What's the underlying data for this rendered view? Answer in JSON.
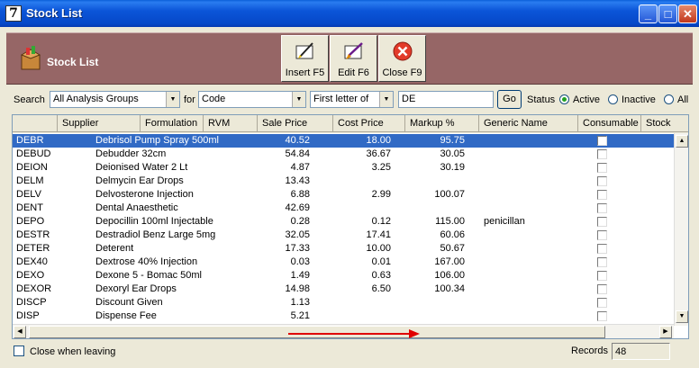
{
  "window": {
    "title": "Stock List",
    "app_icon_label": "7"
  },
  "header": {
    "title": "Stock List"
  },
  "toolbar": {
    "insert": "Insert F5",
    "edit": "Edit F6",
    "close": "Close F9"
  },
  "search": {
    "label": "Search",
    "group": "All Analysis Groups",
    "for_label": "for",
    "field": "Code",
    "mode": "First letter of",
    "value": "DE",
    "go": "Go",
    "status_label": "Status",
    "status_options": [
      "Active",
      "Inactive",
      "All"
    ],
    "status_selected": "Active"
  },
  "grid": {
    "columns": [
      "Supplier",
      "Formulation",
      "RVM",
      "Sale Price",
      "Cost Price",
      "Markup %",
      "Generic Name",
      "Consumable",
      "Stock"
    ],
    "rows": [
      {
        "code": "DEBR",
        "name": "Debrisol Pump Spray 500ml",
        "sale": "40.52",
        "cost": "18.00",
        "markup": "95.75",
        "generic": "",
        "selected": true
      },
      {
        "code": "DEBUD",
        "name": "Debudder 32cm",
        "sale": "54.84",
        "cost": "36.67",
        "markup": "30.05",
        "generic": ""
      },
      {
        "code": "DEION",
        "name": "Deionised Water 2 Lt",
        "sale": "4.87",
        "cost": "3.25",
        "markup": "30.19",
        "generic": ""
      },
      {
        "code": "DELM",
        "name": "Delmycin Ear Drops",
        "sale": "13.43",
        "cost": "",
        "markup": "",
        "generic": ""
      },
      {
        "code": "DELV",
        "name": "Delvosterone  Injection",
        "sale": "6.88",
        "cost": "2.99",
        "markup": "100.07",
        "generic": ""
      },
      {
        "code": "DENT",
        "name": "Dental Anaesthetic",
        "sale": "42.69",
        "cost": "",
        "markup": "",
        "generic": ""
      },
      {
        "code": "DEPO",
        "name": "Depocillin 100ml Injectable",
        "sale": "0.28",
        "cost": "0.12",
        "markup": "115.00",
        "generic": "penicillan"
      },
      {
        "code": "DESTR",
        "name": "Destradiol Benz Large 5mg",
        "sale": "32.05",
        "cost": "17.41",
        "markup": "60.06",
        "generic": ""
      },
      {
        "code": "DETER",
        "name": "Deterent",
        "sale": "17.33",
        "cost": "10.00",
        "markup": "50.67",
        "generic": ""
      },
      {
        "code": "DEX40",
        "name": "Dextrose 40% Injection",
        "sale": "0.03",
        "cost": "0.01",
        "markup": "167.00",
        "generic": ""
      },
      {
        "code": "DEXO",
        "name": "Dexone 5 - Bomac 50ml",
        "sale": "1.49",
        "cost": "0.63",
        "markup": "106.00",
        "generic": ""
      },
      {
        "code": "DEXOR",
        "name": "Dexoryl Ear Drops",
        "sale": "14.98",
        "cost": "6.50",
        "markup": "100.34",
        "generic": ""
      },
      {
        "code": "DISCP",
        "name": "Discount Given",
        "sale": "1.13",
        "cost": "",
        "markup": "",
        "generic": ""
      },
      {
        "code": "DISP",
        "name": "Dispense Fee",
        "sale": "5.21",
        "cost": "",
        "markup": "",
        "generic": ""
      }
    ]
  },
  "footer": {
    "close_when_leaving": "Close when leaving",
    "records_label": "Records",
    "records_value": "48"
  },
  "colors": {
    "band": "#966666",
    "selection": "#316ac5",
    "arrow": "#e00000"
  },
  "icons": [
    "box-icon",
    "insert-icon",
    "edit-icon",
    "close-circle-icon"
  ]
}
